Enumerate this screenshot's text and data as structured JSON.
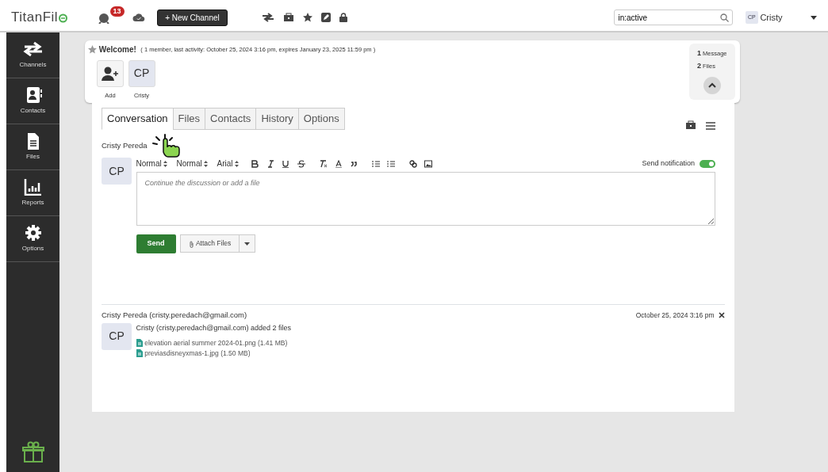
{
  "topbar": {
    "logo": "TitanFil",
    "notification_count": "13",
    "new_channel_button": "+ New Channel",
    "search": {
      "value": "in:active"
    },
    "user": {
      "initials": "CP",
      "name": "Cristy"
    }
  },
  "sidebar": {
    "items": [
      {
        "label": "Channels"
      },
      {
        "label": "Contacts"
      },
      {
        "label": "Files"
      },
      {
        "label": "Reports"
      },
      {
        "label": "Options"
      }
    ]
  },
  "channel": {
    "starred": false,
    "title": "Welcome!",
    "info": "( 1 member, last activity: October 25, 2024 3:16 pm, expires January 23, 2025 11:59 pm )",
    "members": [
      {
        "kind": "add",
        "label": "Add"
      },
      {
        "kind": "member",
        "initials": "CP",
        "label": "Cristy"
      }
    ],
    "stats": [
      {
        "count": "1",
        "label": "Message"
      },
      {
        "count": "2",
        "label": "Files"
      }
    ]
  },
  "tabs": [
    {
      "label": "Conversation",
      "selected": true
    },
    {
      "label": "Files",
      "selected": false
    },
    {
      "label": "Contacts",
      "selected": false
    },
    {
      "label": "History",
      "selected": false
    },
    {
      "label": "Options",
      "selected": false
    }
  ],
  "composer": {
    "author": "Cristy Pereda",
    "initials": "CP",
    "heading_select": "Normal",
    "size_select": "Normal",
    "font_select": "Arial",
    "send_notification": {
      "label": "Send notification",
      "on": true
    },
    "placeholder": "Continue the discussion or add a file",
    "send_button": "Send",
    "attach_button": "Attach Files"
  },
  "messages": [
    {
      "author": "Cristy Pereda (cristy.peredach@gmail.com)",
      "time": "October 25, 2024 3:16 pm",
      "initials": "CP",
      "text": "Cristy (cristy.peredach@gmail.com) added 2 files",
      "files": [
        "elevation aerial summer 2024-01.png (1.41 MB)",
        "previasdisneyxmas-1.jpg (1.50 MB)"
      ]
    }
  ]
}
